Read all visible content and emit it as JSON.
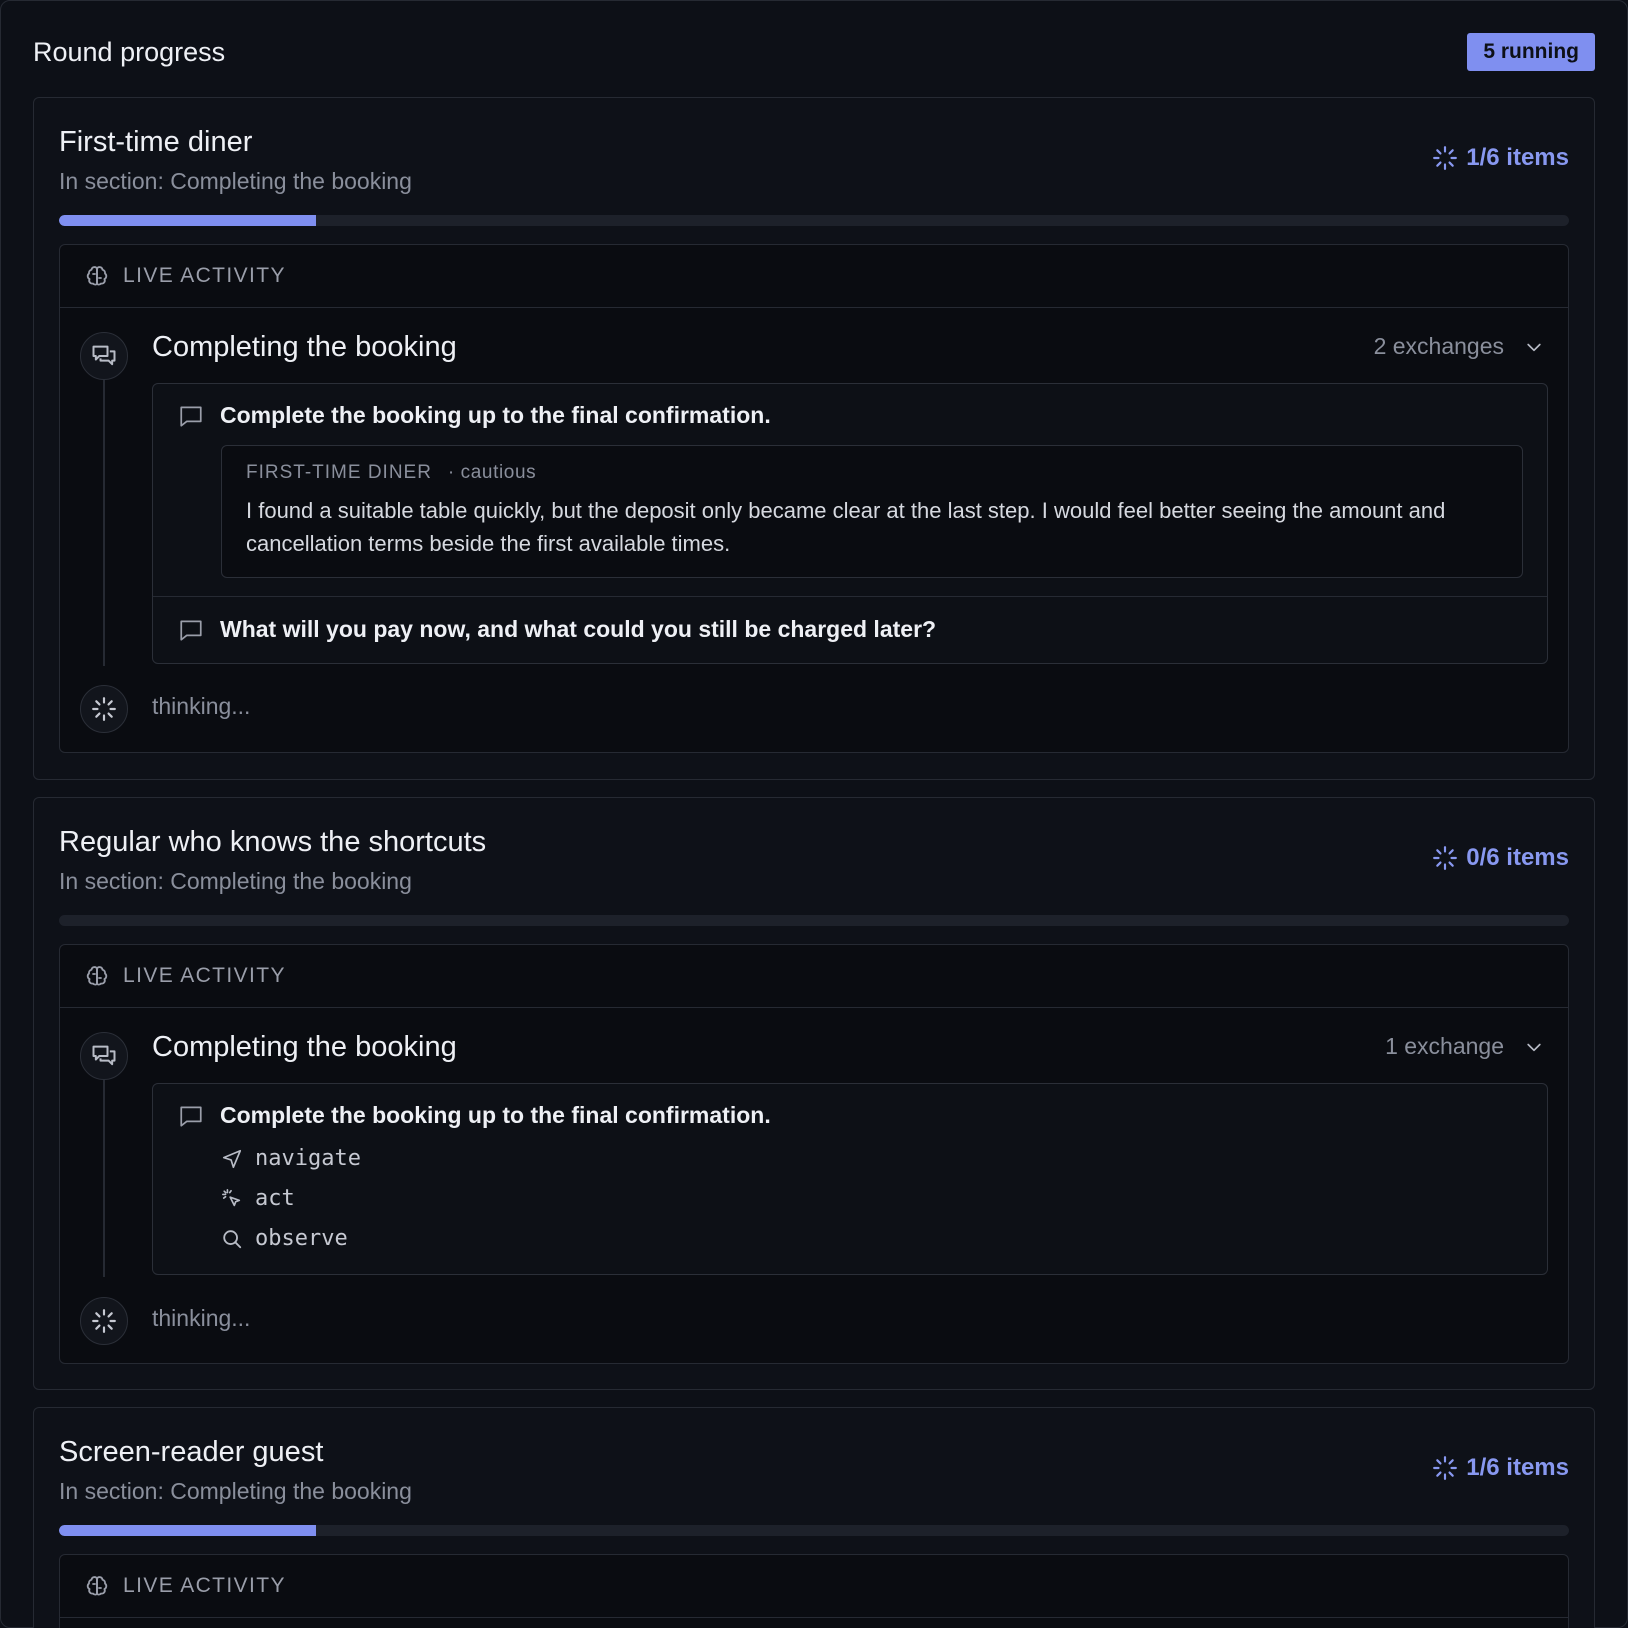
{
  "header": {
    "title": "Round progress",
    "running_badge": "5 running"
  },
  "cards": [
    {
      "title": "First-time diner",
      "subtitle": "In section: Completing the booking",
      "items_count": "1/6 items",
      "progress_fraction": 0.17,
      "activity_label": "LIVE ACTIVITY",
      "section_title": "Completing the booking",
      "exchanges_label": "2 exchanges",
      "exchanges": [
        {
          "prompt": "Complete the booking up to the final confirmation.",
          "quote": {
            "who": "FIRST-TIME DINER",
            "trait": "· cautious",
            "text": "I found a suitable table quickly, but the deposit only became clear at the last step. I would feel better seeing the amount and cancellation terms beside the first available times."
          }
        },
        {
          "prompt": "What will you pay now, and what could you still be charged later?"
        }
      ],
      "thinking": "thinking..."
    },
    {
      "title": "Regular who knows the shortcuts",
      "subtitle": "In section: Completing the booking",
      "items_count": "0/6 items",
      "progress_fraction": 0,
      "activity_label": "LIVE ACTIVITY",
      "section_title": "Completing the booking",
      "exchanges_label": "1 exchange",
      "exchanges": [
        {
          "prompt": "Complete the booking up to the final confirmation.",
          "tools": [
            {
              "icon": "navigate-arrow-icon",
              "label": "navigate"
            },
            {
              "icon": "click-cursor-icon",
              "label": "act"
            },
            {
              "icon": "search-icon",
              "label": "observe"
            }
          ]
        }
      ],
      "thinking": "thinking..."
    },
    {
      "title": "Screen-reader guest",
      "subtitle": "In section: Completing the booking",
      "items_count": "1/6 items",
      "progress_fraction": 0.17,
      "activity_label": "LIVE ACTIVITY"
    }
  ],
  "colors": {
    "accent": "#7f8ff0",
    "background": "#0d1017",
    "muted": "#8a8f9c"
  }
}
